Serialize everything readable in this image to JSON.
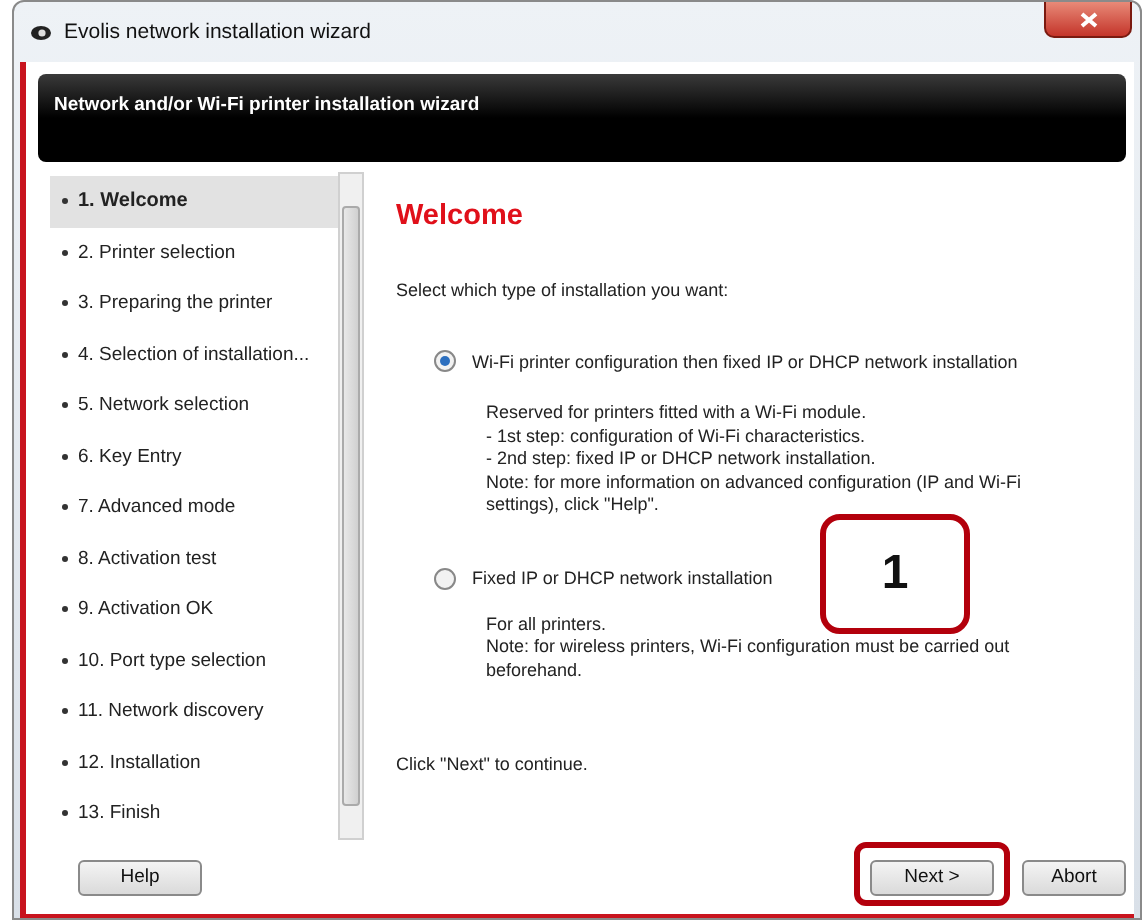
{
  "window": {
    "title": "Evolis network installation wizard"
  },
  "header": {
    "title": "Network and/or Wi-Fi printer installation wizard"
  },
  "steps": [
    {
      "label": "1. Welcome",
      "selected": true
    },
    {
      "label": "2. Printer selection",
      "selected": false
    },
    {
      "label": "3. Preparing the printer",
      "selected": false
    },
    {
      "label": "4. Selection of installation...",
      "selected": false
    },
    {
      "label": "5. Network selection",
      "selected": false
    },
    {
      "label": "6. Key Entry",
      "selected": false
    },
    {
      "label": "7. Advanced mode",
      "selected": false
    },
    {
      "label": "8. Activation test",
      "selected": false
    },
    {
      "label": "9. Activation OK",
      "selected": false
    },
    {
      "label": "10. Port type selection",
      "selected": false
    },
    {
      "label": "11. Network discovery",
      "selected": false
    },
    {
      "label": "12. Installation",
      "selected": false
    },
    {
      "label": "13. Finish",
      "selected": false
    }
  ],
  "content": {
    "heading": "Welcome",
    "prompt": "Select which type of installation you want:",
    "options": [
      {
        "label": "Wi-Fi printer configuration then fixed IP or DHCP network installation",
        "selected": true,
        "description": [
          "Reserved for printers fitted with a Wi-Fi module.",
          "- 1st step: configuration of Wi-Fi characteristics.",
          "- 2nd step: fixed IP or DHCP network installation.",
          "Note: for more information on advanced configuration (IP and Wi-Fi settings), click \"Help\"."
        ]
      },
      {
        "label": "Fixed IP or DHCP network installation",
        "selected": false,
        "description": [
          "For all printers.",
          "Note: for wireless printers, Wi-Fi configuration must be carried out beforehand."
        ]
      }
    ],
    "footer_note": "Click \"Next\" to continue."
  },
  "buttons": {
    "help": "Help",
    "next": "Next >",
    "abort": "Abort"
  },
  "annotations": [
    {
      "kind": "callout",
      "label": "1"
    },
    {
      "kind": "highlight"
    }
  ]
}
